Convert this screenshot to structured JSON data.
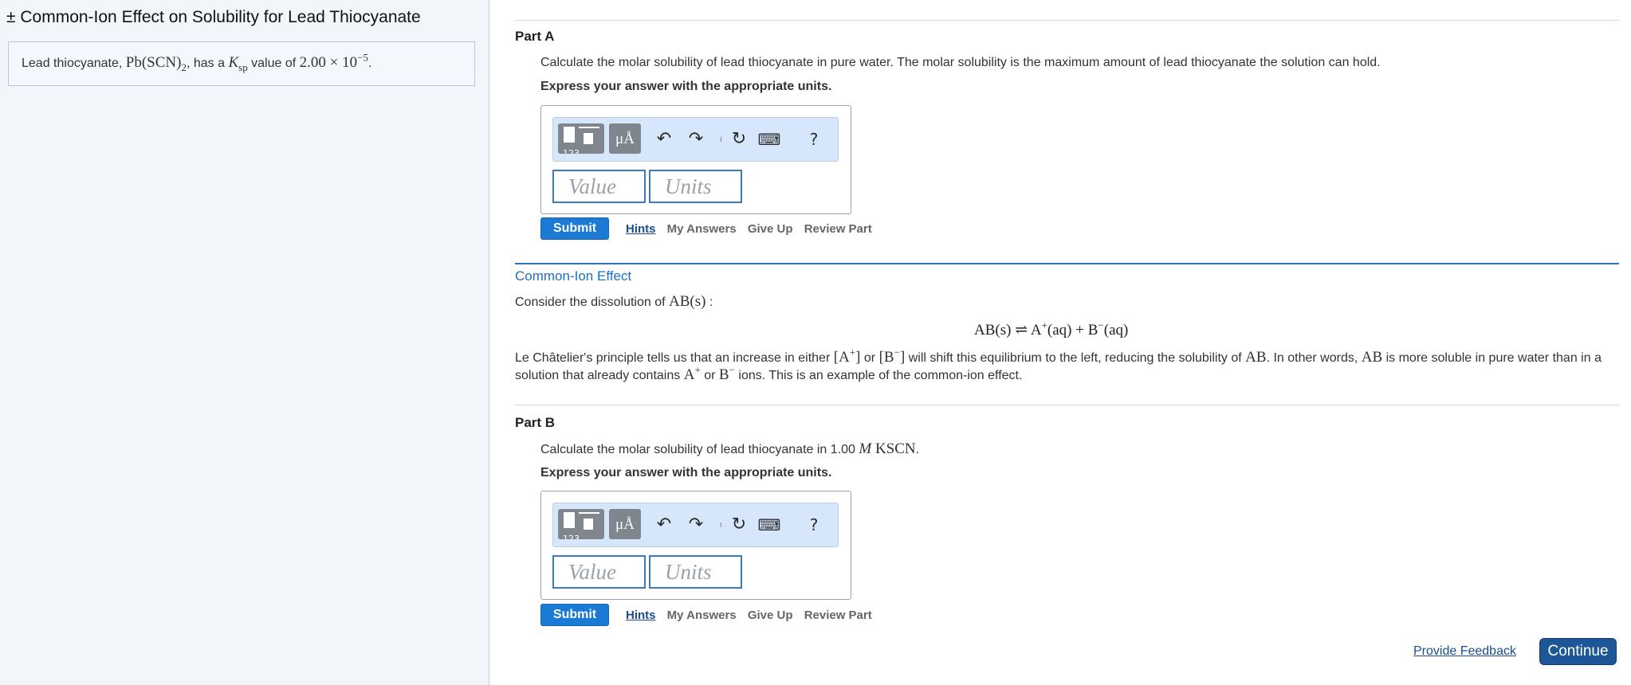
{
  "left_panel": {
    "title": "± Common-Ion Effect on Solubility for Lead Thiocyanate",
    "intro": {
      "prefix": "Lead thiocyanate,",
      "formula": "Pb(SCN)",
      "formula_subscript": "2",
      "mid": ", has a",
      "ksp_symbol": "K",
      "ksp_subscript": "sp",
      "value_label": "value of",
      "value_mantissa": "2.00 × 10",
      "value_exponent": "−5",
      "suffix": "."
    }
  },
  "part_a": {
    "title": "Part A",
    "prompt": "Calculate the molar solubility of lead thiocyanate in pure water. The molar solubility is the maximum amount of lead thiocyanate the solution can hold.",
    "express": "Express your answer with the appropriate units.",
    "toolbar": {
      "templates_icon": "templates-icon",
      "templates_cut_text": "123",
      "units_label": "μÅ",
      "undo_icon": "↶",
      "redo_icon": "↷",
      "reset_icon": "↻",
      "keyboard_icon": "⌨",
      "help_label": "?"
    },
    "value_placeholder": "Value",
    "units_placeholder": "Units",
    "submit": "Submit",
    "links": [
      "Hints",
      "My Answers",
      "Give Up",
      "Review Part"
    ]
  },
  "common_ion": {
    "title": "Common-Ion Effect",
    "consider_prefix": "Consider the dissolution of",
    "consider_formula": "AB(s)",
    "consider_suffix": ":",
    "equation": {
      "left": "AB(s)",
      "arrow": "⇌",
      "right1": "A",
      "right1_sup": "+",
      "right1_state": "(aq)",
      "plus": "+",
      "right2": "B",
      "right2_sup": "−",
      "right2_state": "(aq)"
    },
    "lechatelier": {
      "t1": "Le Châtelier's principle tells us that an increase in either",
      "a_plus": "[A",
      "a_plus_sup": "+",
      "a_close": "]",
      "or1": "or",
      "b_minus": "[B",
      "b_minus_sup": "−",
      "b_close": "]",
      "t2": "will shift this equilibrium to the left, reducing the solubility of",
      "ab1": "AB",
      "t3": ". In other words,",
      "ab2": "AB",
      "t4": "is more soluble in pure water than in a solution that already contains",
      "a": "A",
      "a_sup": "+",
      "or2": "or",
      "b": "B",
      "b_sup": "−",
      "t5": "ions. This is an example of the common-ion effect."
    }
  },
  "part_b": {
    "title": "Part B",
    "prompt_prefix": "Calculate the molar solubility of lead thiocyanate in 1.00",
    "prompt_unit": "M",
    "prompt_compound": "KSCN",
    "prompt_suffix": ".",
    "express": "Express your answer with the appropriate units.",
    "toolbar": {
      "templates_cut_text": "123",
      "units_label": "μÅ",
      "undo_icon": "↶",
      "redo_icon": "↷",
      "reset_icon": "↻",
      "keyboard_icon": "⌨",
      "help_label": "?"
    },
    "value_placeholder": "Value",
    "units_placeholder": "Units",
    "submit": "Submit",
    "links": [
      "Hints",
      "My Answers",
      "Give Up",
      "Review Part"
    ]
  },
  "footer": {
    "feedback": "Provide Feedback",
    "continue": "Continue"
  },
  "colors": {
    "accent_blue": "#1b7ad4",
    "link_blue": "#1a4d8c",
    "section_blue": "#1e6fc2",
    "continue_bg": "#1e5798",
    "left_panel_bg": "#f2f6fb",
    "toolbar_bg": "#d6e7fb"
  }
}
